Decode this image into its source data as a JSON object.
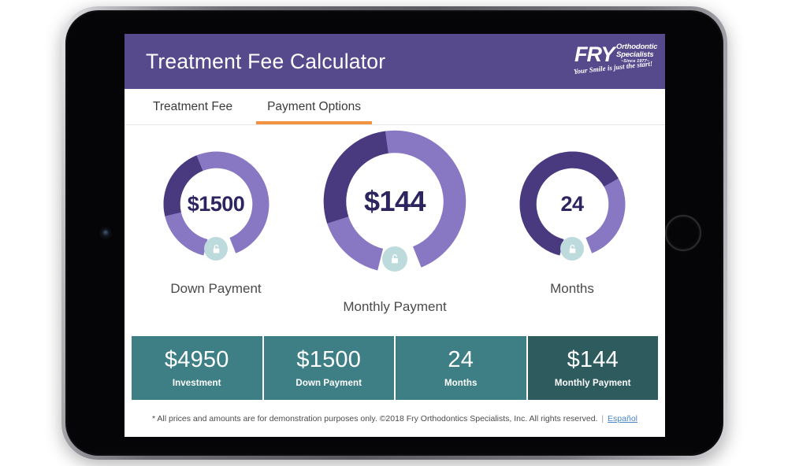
{
  "header": {
    "title": "Treatment Fee Calculator",
    "bg_color": "#564a8d",
    "logo": {
      "mark": "FRY",
      "line1": "Orthodontic",
      "line2": "Specialists",
      "line3": "~Since 1977~",
      "tagline": "Your Smile is just the start!"
    }
  },
  "tabs": [
    {
      "label": "Treatment Fee",
      "active": false
    },
    {
      "label": "Payment Options",
      "active": true
    }
  ],
  "tab_accent_color": "#f39240",
  "dials": [
    {
      "id": "down-payment",
      "value": "$1500",
      "label": "Down Payment",
      "lock_icon": "unlock-icon",
      "percent": 25,
      "track_color": "#8878c4",
      "fill_color": "#493a7f"
    },
    {
      "id": "monthly-payment",
      "value": "$144",
      "label": "Monthly Payment",
      "lock_icon": "unlock-icon",
      "percent": 30,
      "track_color": "#8878c4",
      "fill_color": "#493a7f"
    },
    {
      "id": "months",
      "value": "24",
      "label": "Months",
      "lock_icon": "unlock-icon",
      "percent": 70,
      "track_color": "#8878c4",
      "fill_color": "#493a7f"
    }
  ],
  "summary": {
    "bg_color": "#3e7f85",
    "highlight_color": "#2d5b5e",
    "cells": [
      {
        "value": "$4950",
        "label": "Investment",
        "highlighted": false
      },
      {
        "value": "$1500",
        "label": "Down Payment",
        "highlighted": false
      },
      {
        "value": "24",
        "label": "Months",
        "highlighted": false
      },
      {
        "value": "$144",
        "label": "Monthly Payment",
        "highlighted": true
      }
    ]
  },
  "footer": {
    "disclaimer": "* All prices and amounts are for demonstration purposes only. ©2018 Fry Orthodontics Specialists, Inc. All rights reserved.",
    "divider": "|",
    "espanol_label": "Español"
  }
}
